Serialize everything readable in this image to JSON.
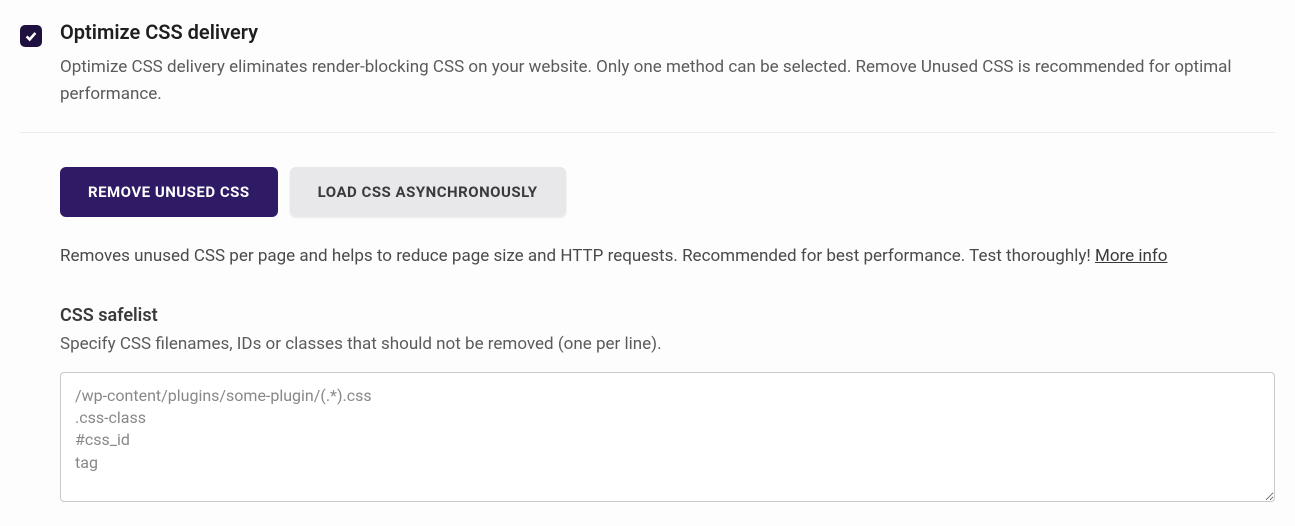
{
  "setting": {
    "title": "Optimize CSS delivery",
    "description": "Optimize CSS delivery eliminates render-blocking CSS on your website. Only one method can be selected. Remove Unused CSS is recommended for optimal performance."
  },
  "tabs": {
    "remove_unused": "REMOVE UNUSED CSS",
    "load_async": "LOAD CSS ASYNCHRONOUSLY"
  },
  "tab_description": "Removes unused CSS per page and helps to reduce page size and HTTP requests. Recommended for best performance. Test thoroughly! ",
  "more_info": "More info",
  "safelist": {
    "title": "CSS safelist",
    "description": "Specify CSS filenames, IDs or classes that should not be removed (one per line).",
    "placeholder": "/wp-content/plugins/some-plugin/(.*).css\n.css-class\n#css_id\ntag"
  }
}
